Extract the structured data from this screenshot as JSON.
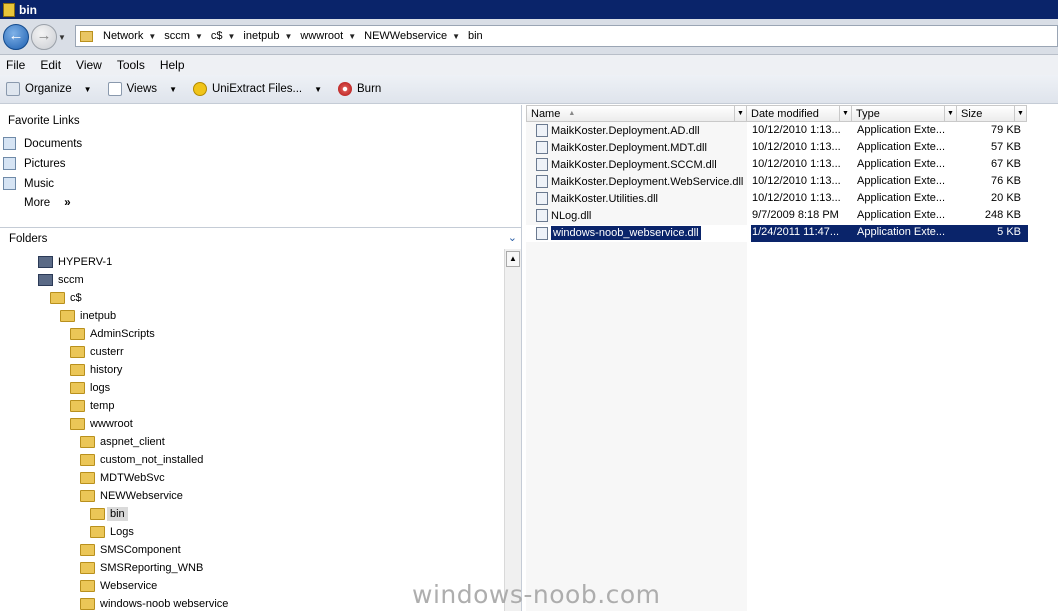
{
  "window": {
    "title": "bin"
  },
  "address": {
    "crumbs": [
      "Network",
      "sccm",
      "c$",
      "inetpub",
      "wwwroot",
      "NEWWebservice",
      "bin"
    ]
  },
  "menu": [
    "File",
    "Edit",
    "View",
    "Tools",
    "Help"
  ],
  "toolbar": {
    "organize": "Organize",
    "views": "Views",
    "uniextract": "UniExtract Files...",
    "burn": "Burn"
  },
  "favorites": {
    "header": "Favorite Links",
    "items": [
      "Documents",
      "Pictures",
      "Music"
    ],
    "more": "More",
    "more_chevron": "»"
  },
  "folders": {
    "header": "Folders",
    "tree": [
      {
        "label": "HYPERV-1",
        "kind": "computer"
      },
      {
        "label": "sccm",
        "kind": "computer"
      },
      {
        "label": "c$",
        "kind": "drive"
      },
      {
        "label": "inetpub",
        "kind": "folder"
      },
      {
        "label": "AdminScripts",
        "kind": "folder"
      },
      {
        "label": "custerr",
        "kind": "folder"
      },
      {
        "label": "history",
        "kind": "folder"
      },
      {
        "label": "logs",
        "kind": "folder"
      },
      {
        "label": "temp",
        "kind": "folder"
      },
      {
        "label": "wwwroot",
        "kind": "folder"
      },
      {
        "label": "aspnet_client",
        "kind": "folder"
      },
      {
        "label": "custom_not_installed",
        "kind": "folder"
      },
      {
        "label": "MDTWebSvc",
        "kind": "folder"
      },
      {
        "label": "NEWWebservice",
        "kind": "folder"
      },
      {
        "label": "bin",
        "kind": "folder",
        "selected": true
      },
      {
        "label": "Logs",
        "kind": "folder"
      },
      {
        "label": "SMSComponent",
        "kind": "folder"
      },
      {
        "label": "SMSReporting_WNB",
        "kind": "folder"
      },
      {
        "label": "Webservice",
        "kind": "folder"
      },
      {
        "label": "windows-noob webservice",
        "kind": "folder"
      }
    ]
  },
  "columns": {
    "name": "Name",
    "date": "Date modified",
    "type": "Type",
    "size": "Size"
  },
  "files": [
    {
      "name": "MaikKoster.Deployment.AD.dll",
      "date": "10/12/2010 1:13...",
      "type": "Application Exte...",
      "size": "79 KB"
    },
    {
      "name": "MaikKoster.Deployment.MDT.dll",
      "date": "10/12/2010 1:13...",
      "type": "Application Exte...",
      "size": "57 KB"
    },
    {
      "name": "MaikKoster.Deployment.SCCM.dll",
      "date": "10/12/2010 1:13...",
      "type": "Application Exte...",
      "size": "67 KB"
    },
    {
      "name": "MaikKoster.Deployment.WebService.dll",
      "date": "10/12/2010 1:13...",
      "type": "Application Exte...",
      "size": "76 KB"
    },
    {
      "name": "MaikKoster.Utilities.dll",
      "date": "10/12/2010 1:13...",
      "type": "Application Exte...",
      "size": "20 KB"
    },
    {
      "name": "NLog.dll",
      "date": "9/7/2009 8:18 PM",
      "type": "Application Exte...",
      "size": "248 KB"
    },
    {
      "name": "windows-noob_webservice.dll",
      "date": "1/24/2011 11:47...",
      "type": "Application Exte...",
      "size": "5 KB",
      "selected": true
    }
  ],
  "watermark": "windows-noob.com"
}
